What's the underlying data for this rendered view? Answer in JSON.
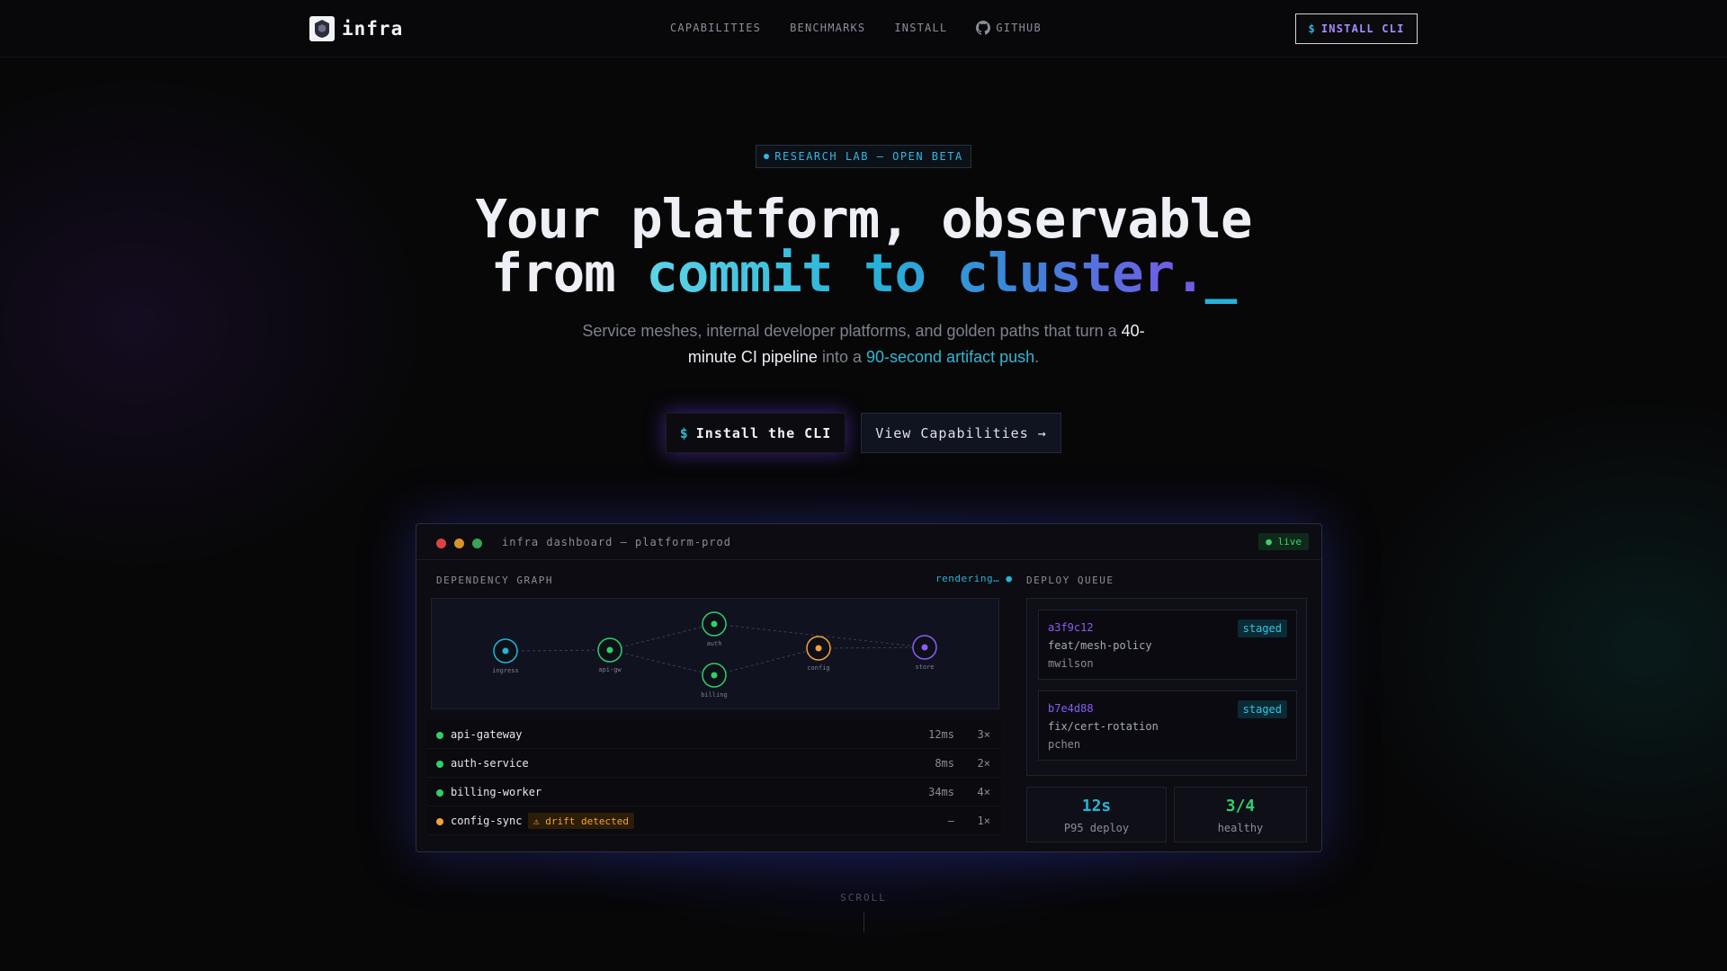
{
  "nav": {
    "brand": "infra",
    "links": [
      {
        "label": "CAPABILITIES"
      },
      {
        "label": "BENCHMARKS"
      },
      {
        "label": "INSTALL"
      },
      {
        "label": "GITHUB",
        "icon": "github-icon"
      }
    ],
    "cta_prefix": "$",
    "cta_label": "INSTALL CLI"
  },
  "hero": {
    "badge": "RESEARCH LAB — OPEN BETA",
    "headline_line1": "Your platform, observable",
    "headline_line2_plain": "from ",
    "headline_line2_gradient": "commit to cluster.",
    "headline_cursor": "_",
    "subtitle_1": "Service meshes, internal developer platforms, and golden paths that turn a ",
    "subtitle_highlight_1": "40-minute CI pipeline",
    "subtitle_2": " into a ",
    "subtitle_highlight_2": "90-second artifact push",
    "subtitle_3": ".",
    "primary_prefix": "$",
    "primary_label": "Install the CLI",
    "secondary_label": "View Capabilities →"
  },
  "dashboard": {
    "title": "infra dashboard — platform-prod",
    "live_label": "● live",
    "graph_label": "DEPENDENCY GRAPH",
    "graph_status": "rendering… ●",
    "nodes": [
      {
        "name": "ingress",
        "color": "#22b5d6"
      },
      {
        "name": "api-gw",
        "color": "#2fcf6a"
      },
      {
        "name": "auth",
        "color": "#2fcf6a"
      },
      {
        "name": "billing",
        "color": "#2fcf6a"
      },
      {
        "name": "config",
        "color": "#f2a23a"
      },
      {
        "name": "store",
        "color": "#8b5cf6"
      }
    ],
    "services": [
      {
        "name": "api-gateway",
        "latency": "12ms",
        "replicas": "3×",
        "status_color": "#2fcf6a"
      },
      {
        "name": "auth-service",
        "latency": "8ms",
        "replicas": "2×",
        "status_color": "#2fcf6a"
      },
      {
        "name": "billing-worker",
        "latency": "34ms",
        "replicas": "4×",
        "status_color": "#2fcf6a"
      },
      {
        "name": "config-sync",
        "latency": "—",
        "replicas": "1×",
        "status_color": "#f2a23a",
        "badge": "⚠ drift detected"
      }
    ],
    "queue_label": "DEPLOY QUEUE",
    "queue": [
      {
        "hash": "a3f9c12",
        "branch": "feat/mesh-policy",
        "author": "mwilson",
        "status": "staged"
      },
      {
        "hash": "b7e4d88",
        "branch": "fix/cert-rotation",
        "author": "pchen",
        "status": "staged"
      }
    ],
    "stats": [
      {
        "value": "12s",
        "label": "P95 deploy",
        "color": "#26b3d8"
      },
      {
        "value": "3/4",
        "label": "healthy",
        "color": "#2fcf6a"
      }
    ]
  },
  "scroll_label": "SCROLL"
}
